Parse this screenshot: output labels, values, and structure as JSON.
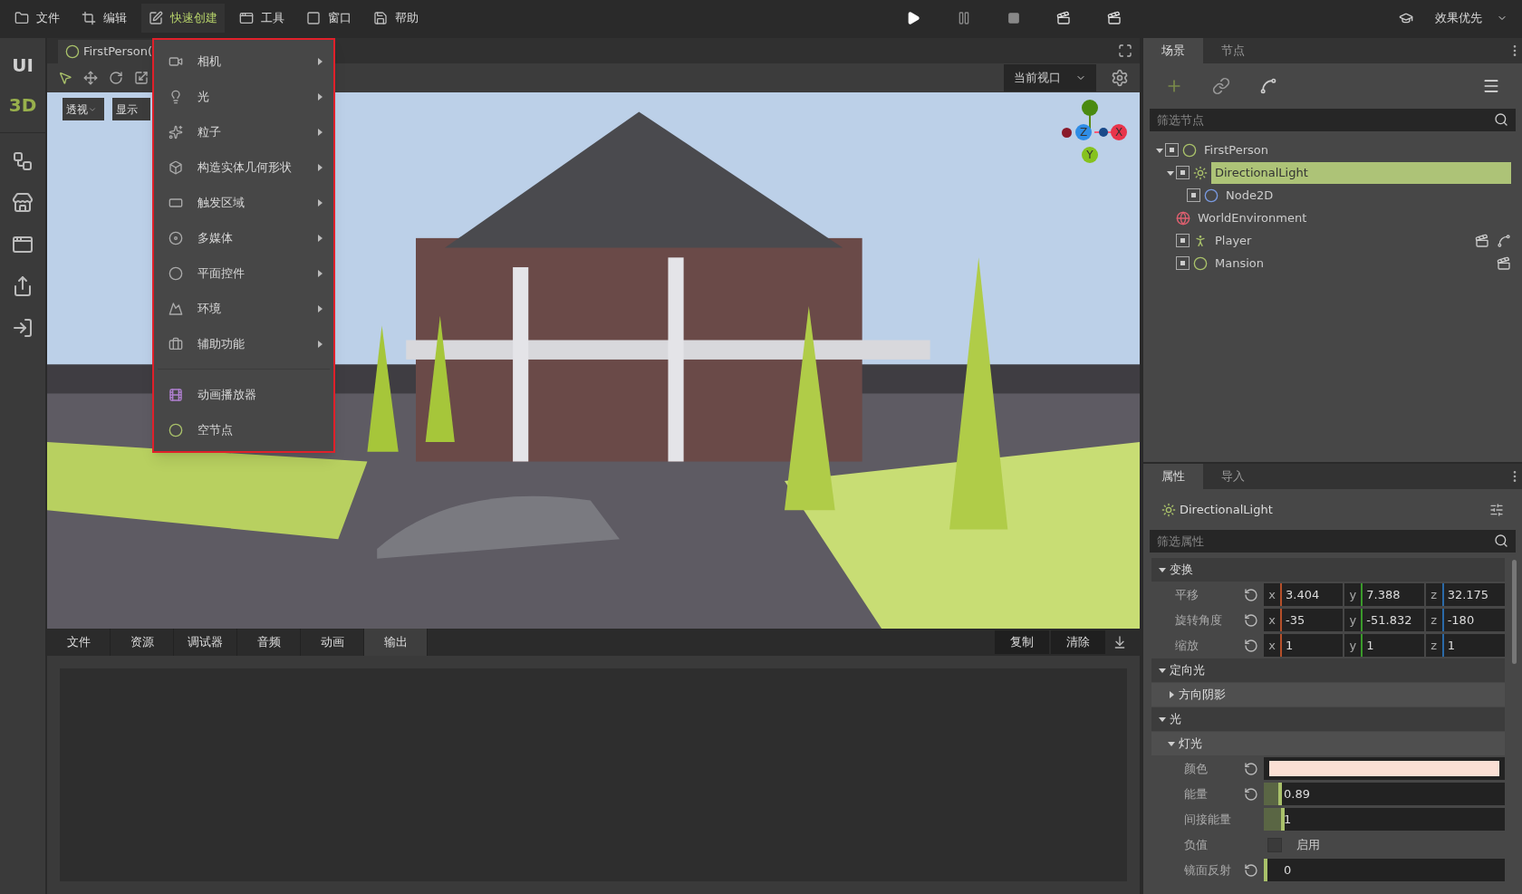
{
  "menubar": {
    "items": [
      {
        "label": "文件",
        "selected": false
      },
      {
        "label": "编辑",
        "selected": false
      },
      {
        "label": "快速创建",
        "selected": true
      },
      {
        "label": "工具",
        "selected": false
      },
      {
        "label": "窗口",
        "selected": false
      },
      {
        "label": "帮助",
        "selected": false
      }
    ],
    "quality": "效果优先"
  },
  "side_tabs": [
    {
      "label": "UI",
      "selected": false
    },
    {
      "label": "3D",
      "selected": true
    }
  ],
  "editor_tab": {
    "title": "FirstPerson("
  },
  "viewport": {
    "projection": "透视",
    "display": "显示",
    "view_select": "当前视口",
    "axes": [
      {
        "label": "X",
        "color": "#e8344a"
      },
      {
        "label": "Y",
        "color": "#86c21e"
      },
      {
        "label": "Z",
        "color": "#2f8de6"
      }
    ]
  },
  "create_menu": {
    "items": [
      {
        "label": "相机",
        "kind": "submenu"
      },
      {
        "label": "光",
        "kind": "submenu"
      },
      {
        "label": "粒子",
        "kind": "submenu"
      },
      {
        "label": "构造实体几何形状",
        "kind": "submenu"
      },
      {
        "label": "触发区域",
        "kind": "submenu"
      },
      {
        "label": "多媒体",
        "kind": "submenu"
      },
      {
        "label": "平面控件",
        "kind": "submenu"
      },
      {
        "label": "环境",
        "kind": "submenu"
      },
      {
        "label": "辅助功能",
        "kind": "submenu"
      },
      {
        "label": "动画播放器",
        "kind": "action"
      },
      {
        "label": "空节点",
        "kind": "action"
      }
    ]
  },
  "bottom_panel": {
    "tabs": [
      {
        "label": "文件",
        "selected": false
      },
      {
        "label": "资源",
        "selected": false
      },
      {
        "label": "调试器",
        "selected": false
      },
      {
        "label": "音频",
        "selected": false
      },
      {
        "label": "动画",
        "selected": false
      },
      {
        "label": "输出",
        "selected": true
      }
    ],
    "buttons": [
      "复制",
      "清除"
    ]
  },
  "scene_panel": {
    "tabs": [
      {
        "label": "场景",
        "selected": true
      },
      {
        "label": "节点",
        "selected": false
      }
    ],
    "filter": {
      "placeholder": "筛选节点"
    },
    "tree": [
      {
        "label": "FirstPerson",
        "kind": "node3d",
        "visible": true,
        "selected": false,
        "expanded": true,
        "instanced": false,
        "scripted": false,
        "children": [
          {
            "label": "DirectionalLight",
            "kind": "light",
            "visible": true,
            "selected": true,
            "expanded": true,
            "instanced": false,
            "scripted": false,
            "children": [
              {
                "label": "Node2D",
                "kind": "node2d",
                "visible": true,
                "selected": false,
                "instanced": false,
                "scripted": false
              }
            ]
          },
          {
            "label": "WorldEnvironment",
            "kind": "environment",
            "selected": false,
            "instanced": false,
            "scripted": false
          },
          {
            "label": "Player",
            "kind": "character",
            "visible": true,
            "selected": false,
            "instanced": true,
            "scripted": true
          },
          {
            "label": "Mansion",
            "kind": "node3d",
            "visible": true,
            "selected": false,
            "instanced": true,
            "scripted": false
          }
        ]
      }
    ]
  },
  "inspector": {
    "tabs": [
      {
        "label": "属性",
        "selected": true
      },
      {
        "label": "导入",
        "selected": false
      }
    ],
    "node": "DirectionalLight",
    "filter": {
      "placeholder": "筛选属性"
    },
    "sections": [
      {
        "title": "变换",
        "expanded": true,
        "rows": [
          {
            "kind": "vector",
            "label": "平移",
            "values": [
              {
                "axis": "x",
                "value": "3.404",
                "color": "#b5502a"
              },
              {
                "axis": "y",
                "value": "7.388",
                "color": "#3a9a2a"
              },
              {
                "axis": "z",
                "value": "32.175",
                "color": "#2a6aa8"
              }
            ]
          },
          {
            "kind": "vector",
            "label": "旋转角度",
            "values": [
              {
                "axis": "x",
                "value": "-35",
                "color": "#b5502a"
              },
              {
                "axis": "y",
                "value": "-51.832",
                "color": "#3a9a2a"
              },
              {
                "axis": "z",
                "value": "-180",
                "color": "#2a6aa8"
              }
            ]
          },
          {
            "kind": "vector",
            "label": "缩放",
            "values": [
              {
                "axis": "x",
                "value": "1",
                "color": "#b5502a"
              },
              {
                "axis": "y",
                "value": "1",
                "color": "#3a9a2a"
              },
              {
                "axis": "z",
                "value": "1",
                "color": "#2a6aa8"
              }
            ]
          }
        ]
      },
      {
        "title": "定向光",
        "expanded": true,
        "subsections": [
          {
            "title": "方向阴影",
            "expanded": false
          }
        ]
      },
      {
        "title": "光",
        "expanded": true,
        "subsections": [
          {
            "title": "灯光",
            "expanded": true,
            "rows": [
              {
                "kind": "color",
                "label": "颜色",
                "color": "#fadfd4",
                "resettable": true
              },
              {
                "kind": "slider",
                "label": "能量",
                "value": "0.89",
                "level": 0.06,
                "resettable": true
              },
              {
                "kind": "slider",
                "label": "间接能量",
                "value": "1",
                "level": 0.07,
                "resettable": false
              },
              {
                "kind": "checkbox",
                "label": "负值",
                "text": "启用",
                "checked": false,
                "resettable": false
              },
              {
                "kind": "slider",
                "label": "镜面反射",
                "value": "0",
                "level": 0.0,
                "resettable": true
              }
            ]
          }
        ]
      }
    ]
  }
}
